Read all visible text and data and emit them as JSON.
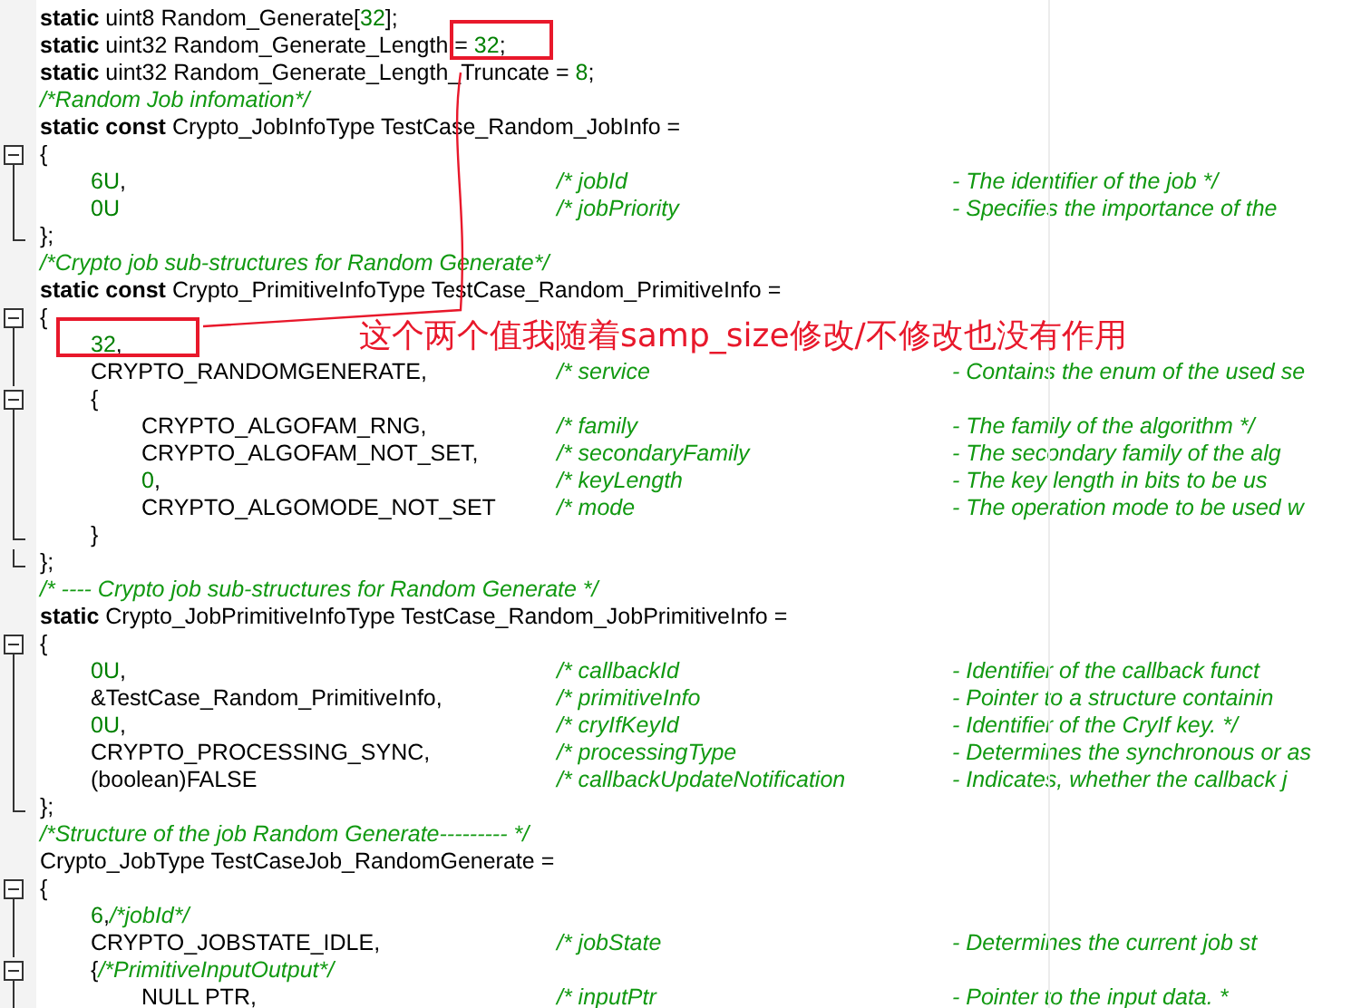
{
  "code_lines": [
    {
      "parts": [
        {
          "kind": "keyword",
          "text": "static"
        },
        {
          "kind": "plain",
          "text": " uint8 Random_Generate["
        },
        {
          "kind": "number",
          "text": "32"
        },
        {
          "kind": "plain",
          "text": "];"
        }
      ]
    },
    {
      "parts": [
        {
          "kind": "keyword",
          "text": "static"
        },
        {
          "kind": "plain",
          "text": " uint32 Random_Generate_Length = "
        },
        {
          "kind": "number",
          "text": "32"
        },
        {
          "kind": "plain",
          "text": ";"
        }
      ]
    },
    {
      "parts": [
        {
          "kind": "keyword",
          "text": "static"
        },
        {
          "kind": "plain",
          "text": " uint32 Random_Generate_Length_Truncate = "
        },
        {
          "kind": "number",
          "text": "8"
        },
        {
          "kind": "plain",
          "text": ";"
        }
      ]
    },
    {
      "parts": [
        {
          "kind": "comment",
          "text": "/*Random Job infomation*/"
        }
      ]
    },
    {
      "parts": [
        {
          "kind": "keyword",
          "text": "static const"
        },
        {
          "kind": "plain",
          "text": " Crypto_JobInfoType TestCase_Random_JobInfo ="
        }
      ]
    },
    {
      "kind": "start",
      "parts": [
        {
          "kind": "plain",
          "text": "{"
        }
      ]
    },
    {
      "kind": "mid",
      "parts": [
        {
          "kind": "number",
          "text": "\t6U"
        },
        {
          "kind": "plain",
          "text": ","
        }
      ],
      "comment": "/* jobId",
      "desc": "- The identifier of the job */"
    },
    {
      "kind": "mid",
      "parts": [
        {
          "kind": "number",
          "text": "\t0U"
        }
      ],
      "comment": "/* jobPriority",
      "desc": "- Specifies the importance of the"
    },
    {
      "kind": "end",
      "parts": [
        {
          "kind": "plain",
          "text": "};"
        }
      ]
    },
    {
      "parts": [
        {
          "kind": "comment",
          "text": "/*Crypto job sub-structures for Random Generate*/"
        }
      ]
    },
    {
      "parts": [
        {
          "kind": "keyword",
          "text": "static const"
        },
        {
          "kind": "plain",
          "text": " Crypto_PrimitiveInfoType TestCase_Random_PrimitiveInfo ="
        }
      ]
    },
    {
      "kind": "start",
      "parts": [
        {
          "kind": "plain",
          "text": "{"
        }
      ]
    },
    {
      "kind": "mid",
      "parts": [
        {
          "kind": "number",
          "text": "\t32"
        },
        {
          "kind": "plain",
          "text": ","
        }
      ]
    },
    {
      "kind": "mid",
      "parts": [
        {
          "kind": "plain",
          "text": "\tCRYPTO_RANDOMGENERATE,"
        }
      ],
      "comment": "/* service",
      "desc": "- Contains the enum of the used se"
    },
    {
      "kind": "start",
      "parts": [
        {
          "kind": "plain",
          "text": "\t{"
        }
      ]
    },
    {
      "kind": "mid",
      "parts": [
        {
          "kind": "plain",
          "text": "\t\tCRYPTO_ALGOFAM_RNG,"
        }
      ],
      "comment": "/* family",
      "desc": "- The family of the algorithm */"
    },
    {
      "kind": "mid",
      "parts": [
        {
          "kind": "plain",
          "text": "\t\tCRYPTO_ALGOFAM_NOT_SET,"
        }
      ],
      "comment": "/* secondaryFamily",
      "desc": "- The secondary family of the alg"
    },
    {
      "kind": "mid",
      "parts": [
        {
          "kind": "number",
          "text": "\t\t0"
        },
        {
          "kind": "plain",
          "text": ","
        }
      ],
      "comment": "/* keyLength",
      "desc": "- The key length in bits to be us"
    },
    {
      "kind": "mid",
      "parts": [
        {
          "kind": "plain",
          "text": "\t\tCRYPTO_ALGOMODE_NOT_SET"
        }
      ],
      "comment": "/* mode",
      "desc": "- The operation mode to be used w"
    },
    {
      "kind": "end",
      "parts": [
        {
          "kind": "plain",
          "text": "\t}"
        }
      ]
    },
    {
      "kind": "end",
      "parts": [
        {
          "kind": "plain",
          "text": "};"
        }
      ]
    },
    {
      "parts": [
        {
          "kind": "comment",
          "text": "/* ---- Crypto job sub-structures for Random Generate */"
        }
      ]
    },
    {
      "parts": [
        {
          "kind": "keyword",
          "text": "static"
        },
        {
          "kind": "plain",
          "text": " Crypto_JobPrimitiveInfoType TestCase_Random_JobPrimitiveInfo ="
        }
      ]
    },
    {
      "kind": "start",
      "parts": [
        {
          "kind": "plain",
          "text": "{"
        }
      ]
    },
    {
      "kind": "mid",
      "parts": [
        {
          "kind": "number",
          "text": "\t0U"
        },
        {
          "kind": "plain",
          "text": ","
        }
      ],
      "comment": "/* callbackId",
      "desc": "- Identifier of the callback funct"
    },
    {
      "kind": "mid",
      "parts": [
        {
          "kind": "plain",
          "text": "\t&TestCase_Random_PrimitiveInfo,"
        }
      ],
      "comment": "/* primitiveInfo",
      "desc": "- Pointer to a structure containin"
    },
    {
      "kind": "mid",
      "parts": [
        {
          "kind": "number",
          "text": "\t0U"
        },
        {
          "kind": "plain",
          "text": ","
        }
      ],
      "comment": "/* cryIfKeyId",
      "desc": "- Identifier of the CryIf key. */"
    },
    {
      "kind": "mid",
      "parts": [
        {
          "kind": "plain",
          "text": "\tCRYPTO_PROCESSING_SYNC,"
        }
      ],
      "comment": "/* processingType",
      "desc": "- Determines the synchronous or as"
    },
    {
      "kind": "mid",
      "parts": [
        {
          "kind": "plain",
          "text": "\t(boolean)FALSE"
        }
      ],
      "comment": "/* callbackUpdateNotification",
      "desc": "- Indicates, whether the callback j"
    },
    {
      "kind": "end",
      "parts": [
        {
          "kind": "plain",
          "text": "};"
        }
      ]
    },
    {
      "parts": [
        {
          "kind": "comment",
          "text": "/*Structure of the job Random Generate--------- */"
        }
      ]
    },
    {
      "parts": [
        {
          "kind": "plain",
          "text": "Crypto_JobType TestCaseJob_RandomGenerate ="
        }
      ]
    },
    {
      "kind": "start",
      "parts": [
        {
          "kind": "plain",
          "text": "{"
        }
      ]
    },
    {
      "kind": "mid",
      "parts": [
        {
          "kind": "number",
          "text": "\t6"
        },
        {
          "kind": "plain",
          "text": ","
        },
        {
          "kind": "comment",
          "text": "/*jobId*/"
        }
      ]
    },
    {
      "kind": "mid",
      "parts": [
        {
          "kind": "plain",
          "text": "\tCRYPTO_JOBSTATE_IDLE,"
        }
      ],
      "comment": "/* jobState",
      "desc": "- Determines the current job st"
    },
    {
      "kind": "start",
      "parts": [
        {
          "kind": "plain",
          "text": "\t{"
        },
        {
          "kind": "comment",
          "text": "/*PrimitiveInputOutput*/"
        }
      ]
    },
    {
      "kind": "mid",
      "parts": [
        {
          "kind": "plain",
          "text": "\t\tNULL PTR,"
        }
      ],
      "comment": "/* inputPtr",
      "desc": "- Pointer to the input data. *"
    }
  ],
  "annotation": {
    "note": "这个两个值我随着samp_size修改/不修改也没有作用"
  }
}
